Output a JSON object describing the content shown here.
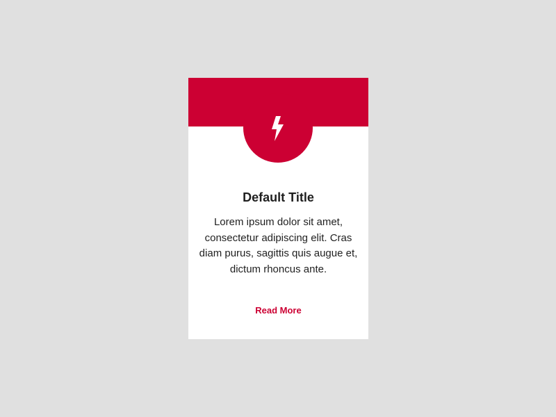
{
  "colors": {
    "accent": "#cc0033",
    "background": "#e0e0e0",
    "card": "#ffffff",
    "text": "#1f1f1f",
    "icon": "#ffffff"
  },
  "card": {
    "icon": "lightning-bolt-icon",
    "title": "Default Title",
    "body": "Lorem ipsum dolor sit amet, consectetur adipiscing elit. Cras diam purus, sagittis quis augue et, dictum rhoncus ante.",
    "link_label": "Read More"
  }
}
